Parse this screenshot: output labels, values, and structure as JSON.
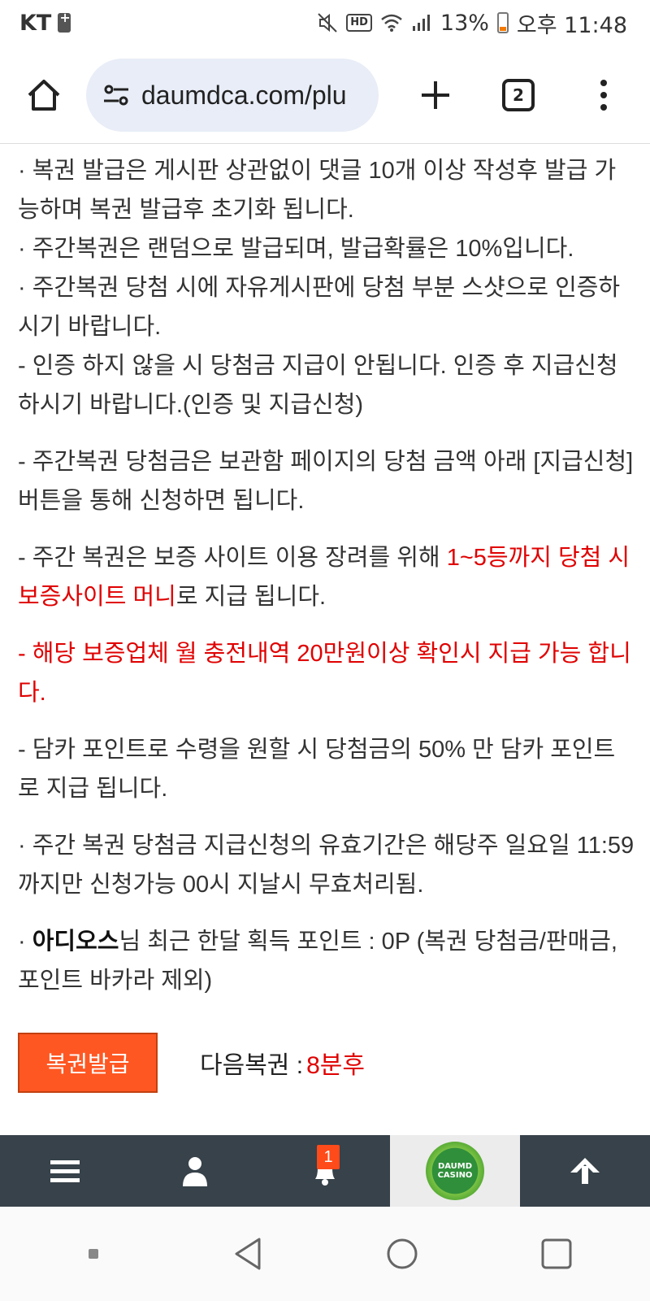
{
  "status_bar": {
    "carrier": "KT",
    "battery": "13%",
    "time": "오후 11:48"
  },
  "browser": {
    "url": "daumdca.com/plu",
    "tab_count": "2"
  },
  "notice": {
    "lines": [
      "· 복권 발급은 게시판 상관없이 댓글 10개 이상 작성후 발급 가능하며 복권 발급후 초기화 됩니다.",
      "· 주간복권은 랜덤으로 발급되며, 발급확률은 10%입니다.",
      "· 주간복권 당첨 시에 자유게시판에 당첨 부분 스샷으로 인증하시기 바랍니다.",
      "- 인증 하지 않을 시 당첨금 지급이 안됩니다. 인증 후 지급신청 하시기 바랍니다.(인증 및 지급신청)"
    ],
    "claim_line": "- 주간복권 당첨금은 보관함 페이지의 당첨 금액 아래 [지급신청] 버튼을 통해 신청하면 됩니다.",
    "money_prefix": "- 주간 복권은 보증 사이트 이용 장려를 위해 ",
    "money_highlight": "1~5등까지 당첨 시 보증사이트 머니",
    "money_suffix": "로 지급 됩니다.",
    "condition_line": "- 해당 보증업체 월 충전내역 20만원이상 확인시 지급 가능 합니다.",
    "point_line": "- 담카 포인트로 수령을 원할 시 당첨금의 50% 만 담카 포인트로 지급 됩니다.",
    "validity_line": "· 주간 복권 당첨금 지급신청의 유효기간은 해당주 일요일 11:59까지만 신청가능 00시 지날시 무효처리됨.",
    "user_bullet": "· ",
    "user_name": "아디오스",
    "user_suffix": "님 최근 한달 획득 포인트 : 0P (복권 당첨금/판매금, 포인트 바카라 제외)"
  },
  "actions": {
    "issue_button": "복권발급",
    "next_label": "다음복권 : ",
    "next_value": "8분후"
  },
  "bottom_nav": {
    "notification_count": "1",
    "logo_text_top": "DAUMD",
    "logo_text_bottom": "CASINO"
  },
  "colors": {
    "accent_red": "#e00000",
    "button_orange": "#ff5722",
    "nav_dark": "#37424a"
  }
}
